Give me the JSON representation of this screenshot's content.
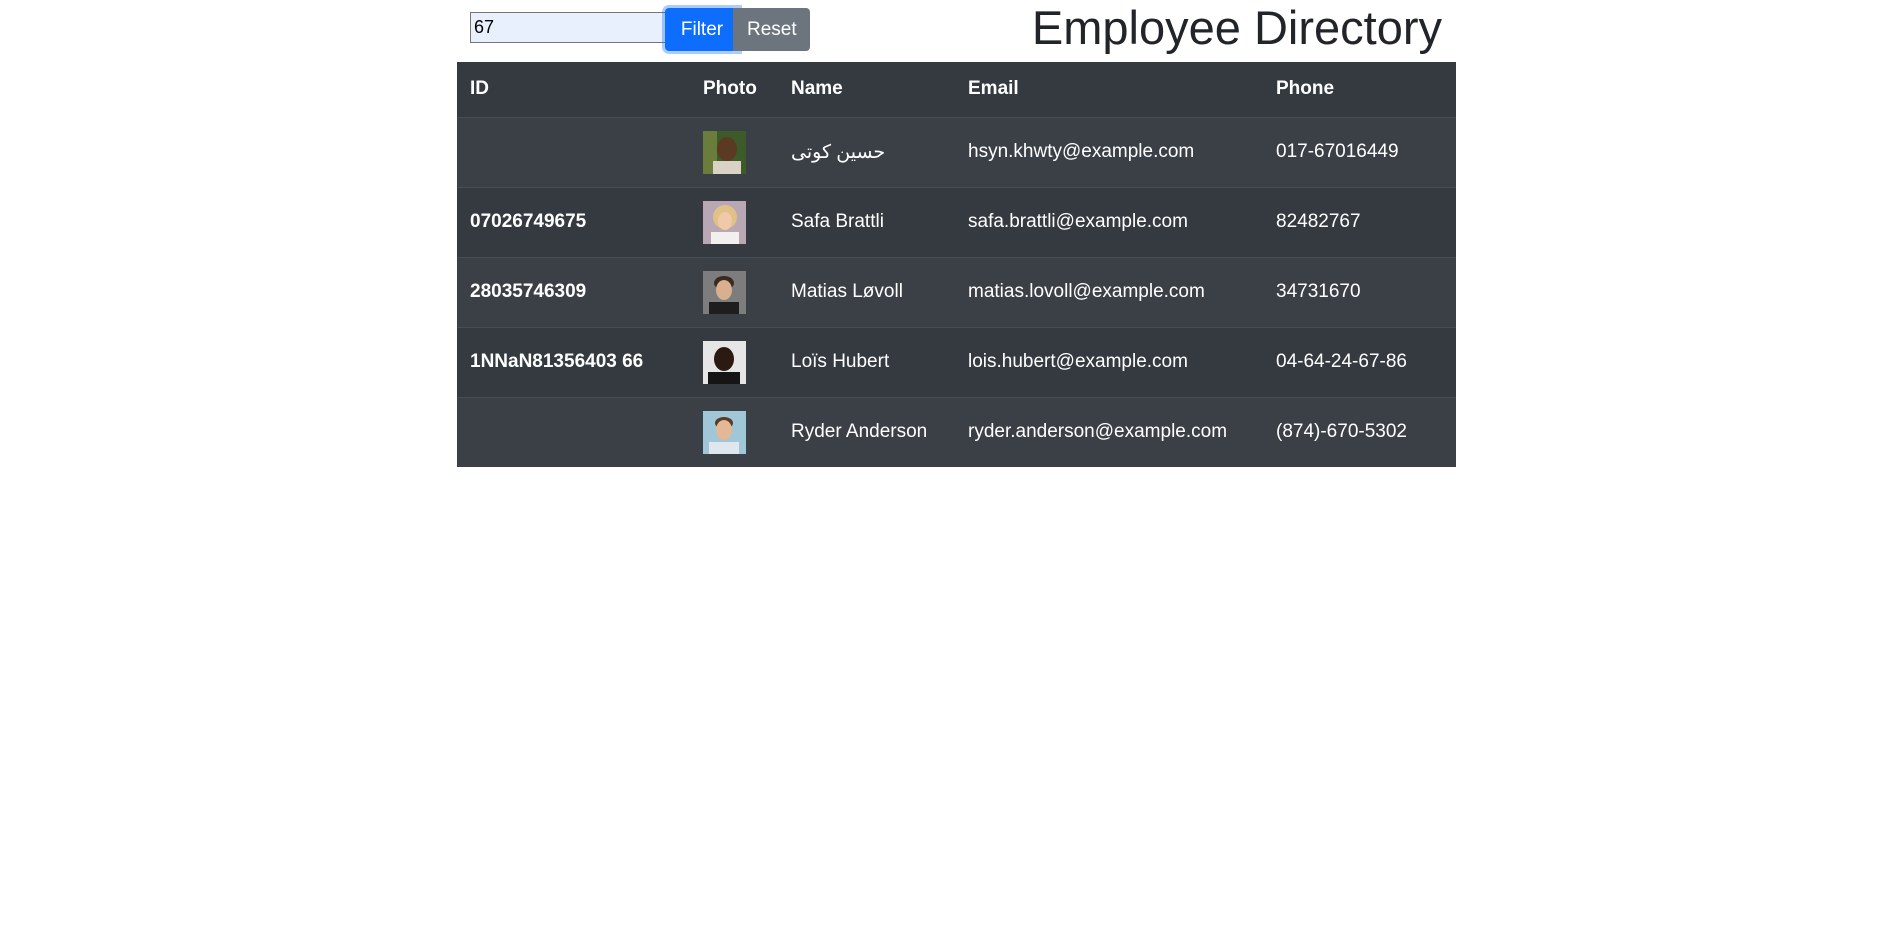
{
  "search": {
    "value": "67"
  },
  "toolbar": {
    "filter_label": "Filter",
    "reset_label": "Reset"
  },
  "header": {
    "title": "Employee Directory"
  },
  "table": {
    "columns": [
      "ID",
      "Photo",
      "Name",
      "Email",
      "Phone"
    ],
    "rows": [
      {
        "id": "",
        "photo": "avatar-photo",
        "name": "حسین کوتی",
        "email": "hsyn.khwty@example.com",
        "phone": "017-67016449"
      },
      {
        "id": "07026749675",
        "photo": "avatar-photo",
        "name": "Safa Brattli",
        "email": "safa.brattli@example.com",
        "phone": "82482767"
      },
      {
        "id": "28035746309",
        "photo": "avatar-photo",
        "name": "Matias Løvoll",
        "email": "matias.lovoll@example.com",
        "phone": "34731670"
      },
      {
        "id": "1NNaN81356403 66",
        "photo": "avatar-photo",
        "name": "Loïs Hubert",
        "email": "lois.hubert@example.com",
        "phone": "04-64-24-67-86"
      },
      {
        "id": "",
        "photo": "avatar-photo",
        "name": "Ryder Anderson",
        "email": "ryder.anderson@example.com",
        "phone": "(874)-670-5302"
      }
    ]
  },
  "colors": {
    "primary": "#0d6efd",
    "secondary": "#6c757d",
    "table_dark": "#343a40",
    "table_stripe": "#3b4046"
  }
}
